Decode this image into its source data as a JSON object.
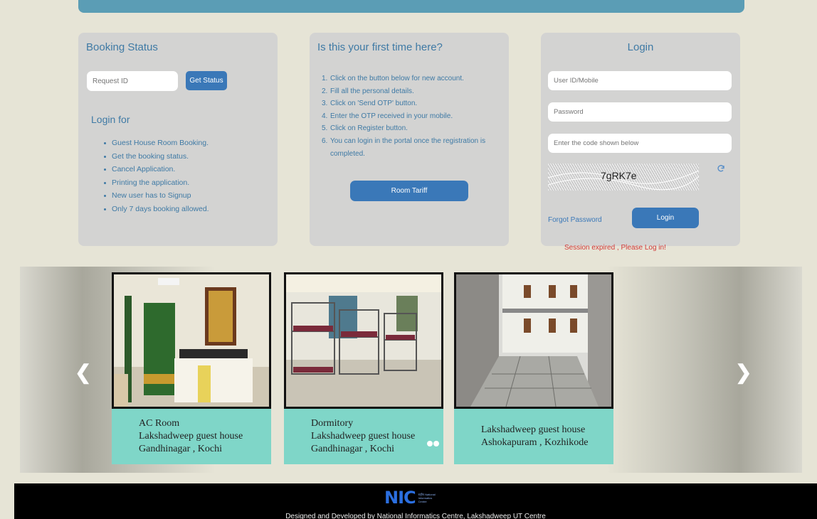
{
  "booking": {
    "title": "Booking Status",
    "request_placeholder": "Request ID",
    "get_status_label": "Get Status",
    "login_for_title": "Login for",
    "login_for_items": [
      "Guest House Room Booking.",
      "Get the booking status.",
      "Cancel Application.",
      "Printing the application.",
      "New user has to Signup",
      "Only 7 days booking allowed."
    ]
  },
  "firsttime": {
    "title": "Is this your first time here?",
    "steps": [
      {
        "num": "1.",
        "text": "Click on the button below for new account."
      },
      {
        "num": "2.",
        "text": "Fill all the personal details."
      },
      {
        "num": "3.",
        "text": "Click on 'Send OTP' button."
      },
      {
        "num": "4.",
        "text": "Enter the OTP received in your mobile."
      },
      {
        "num": "5.",
        "text": "Click on Register button."
      },
      {
        "num": "6.",
        "text": "You can login in the portal once the registration is completed."
      }
    ],
    "room_tariff_label": "Room Tariff"
  },
  "login": {
    "title": "Login",
    "user_placeholder": "User ID/Mobile",
    "password_placeholder": "Password",
    "captcha_placeholder": "Enter the code shown below",
    "captcha_text": "7gRK7e",
    "forgot_label": "Forgot Password",
    "login_label": "Login",
    "session_message": "Session expired , Please Log in!"
  },
  "carousel": {
    "cards": [
      {
        "lines": [
          "AC Room",
          "Lakshadweep guest house",
          "Gandhinagar , Kochi"
        ]
      },
      {
        "lines": [
          "Dormitory",
          "Lakshadweep guest house",
          "Gandhinagar , Kochi"
        ]
      },
      {
        "lines": [
          "Lakshadweep guest house",
          "Ashokapuram , Kozhikode"
        ]
      }
    ],
    "prev_icon": "chevron-left-icon",
    "next_icon": "chevron-right-icon"
  },
  "footer": {
    "logo_text": "NIC",
    "logo_sub": "राष्ट्रीय National Informatics Centre",
    "credit": "Designed and Developed by National Informatics Centre, Lakshadweep UT Centre"
  },
  "colors": {
    "accent": "#3a78b8",
    "caption_bg": "#7fd6c8",
    "error": "#d23a3a"
  }
}
